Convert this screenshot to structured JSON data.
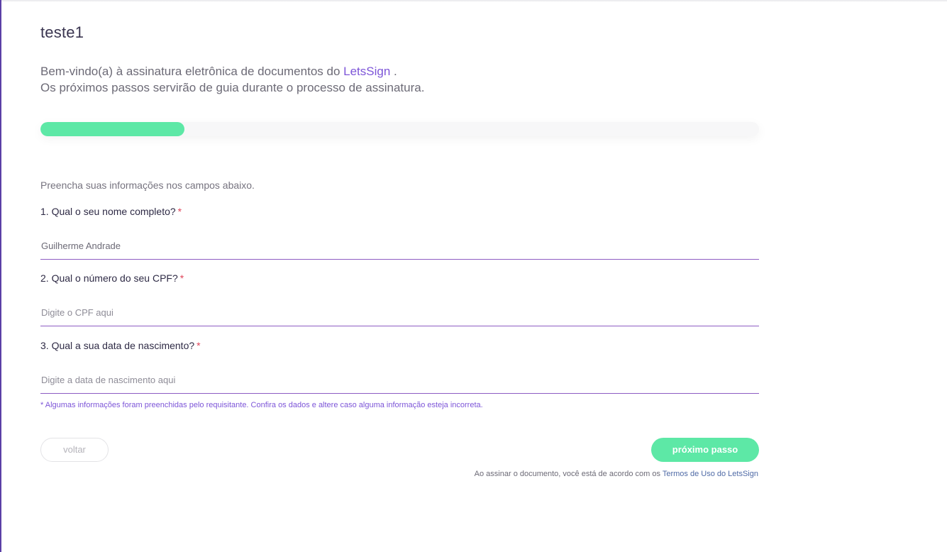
{
  "document": {
    "title": "teste1"
  },
  "welcome": {
    "line1_prefix": "Bem-vindo(a) à assinatura eletrônica de documentos do",
    "brand": "LetsSign",
    "line1_suffix": " .",
    "line2": "Os próximos passos servirão de guia durante o processo de assinatura."
  },
  "progress": {
    "fraction": 0.2,
    "color": "#5de8a6"
  },
  "form": {
    "instructions": "Preencha suas informações nos campos abaixo.",
    "required_mark": "*",
    "fields": [
      {
        "label": "1. Qual o seu nome completo?",
        "value": "Guilherme Andrade",
        "placeholder": ""
      },
      {
        "label": "2. Qual o número do seu CPF?",
        "value": "",
        "placeholder": "Digite o CPF aqui"
      },
      {
        "label": "3. Qual a sua data de nascimento?",
        "value": "",
        "placeholder": "Digite a data de nascimento aqui"
      }
    ],
    "notice": "* Algumas informações foram preenchidas pelo requisitante. Confira os dados e altere caso alguma informação esteja incorreta."
  },
  "actions": {
    "back_label": "voltar",
    "next_label": "próximo passo"
  },
  "terms": {
    "prefix": "Ao assinar o documento, você está de acordo com os",
    "link": "Termos de Uso do LetsSign"
  },
  "colors": {
    "accent": "#7d55d8",
    "success": "#5de8a6",
    "required": "#e0455a",
    "input_underline": "#8d5cc3"
  }
}
